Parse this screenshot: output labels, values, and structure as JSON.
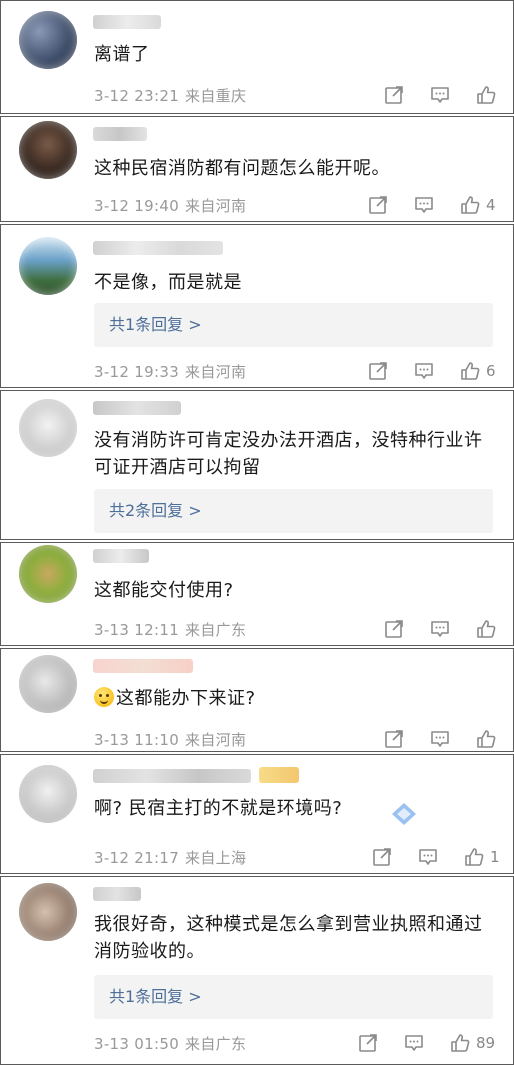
{
  "comments": [
    {
      "text": "离谱了",
      "date": "3-12 23:21",
      "location": "来自重庆",
      "likes": "",
      "reply": "",
      "avatar_color": "#4a5a74"
    },
    {
      "text": "这种民宿消防都有问题怎么能开呢。",
      "date": "3-12 19:40",
      "location": "来自河南",
      "likes": "4",
      "reply": "",
      "avatar_color": "#3b2a22"
    },
    {
      "text": "不是像，而是就是",
      "date": "3-12 19:33",
      "location": "来自河南",
      "likes": "6",
      "reply": "共1条回复 >",
      "avatar_color": "#5a8fb8"
    },
    {
      "text": "没有消防许可肯定没办法开酒店，没特种行业许可证开酒店可以拘留",
      "date": "",
      "location": "",
      "likes": "",
      "reply": "共2条回复 >",
      "avatar_color": "#b8b8b8"
    },
    {
      "text": "这都能交付使用?",
      "date": "3-13 12:11",
      "location": "来自广东",
      "likes": "",
      "reply": "",
      "avatar_color": "#8fae3e"
    },
    {
      "text": "这都能办下来证?",
      "date": "3-13 11:10",
      "location": "来自河南",
      "likes": "",
      "reply": "",
      "avatar_color": "#bdbdbd"
    },
    {
      "text": "啊? 民宿主打的不就是环境吗?",
      "date": "3-12 21:17",
      "location": "来自上海",
      "likes": "1",
      "reply": "",
      "avatar_color": "#c9c9c9"
    },
    {
      "text": "我很好奇，这种模式是怎么拿到营业执照和通过消防验收的。",
      "date": "3-13 01:50",
      "location": "来自广东",
      "likes": "89",
      "reply": "共1条回复 >",
      "avatar_color": "#9a8272"
    }
  ],
  "icons": {
    "share": "share-icon",
    "comment": "comment-icon",
    "like": "thumbs-up-icon"
  },
  "colors": {
    "reply_link": "#4d6f9a",
    "meta_text": "#999999",
    "border": "#5a5a5a"
  }
}
